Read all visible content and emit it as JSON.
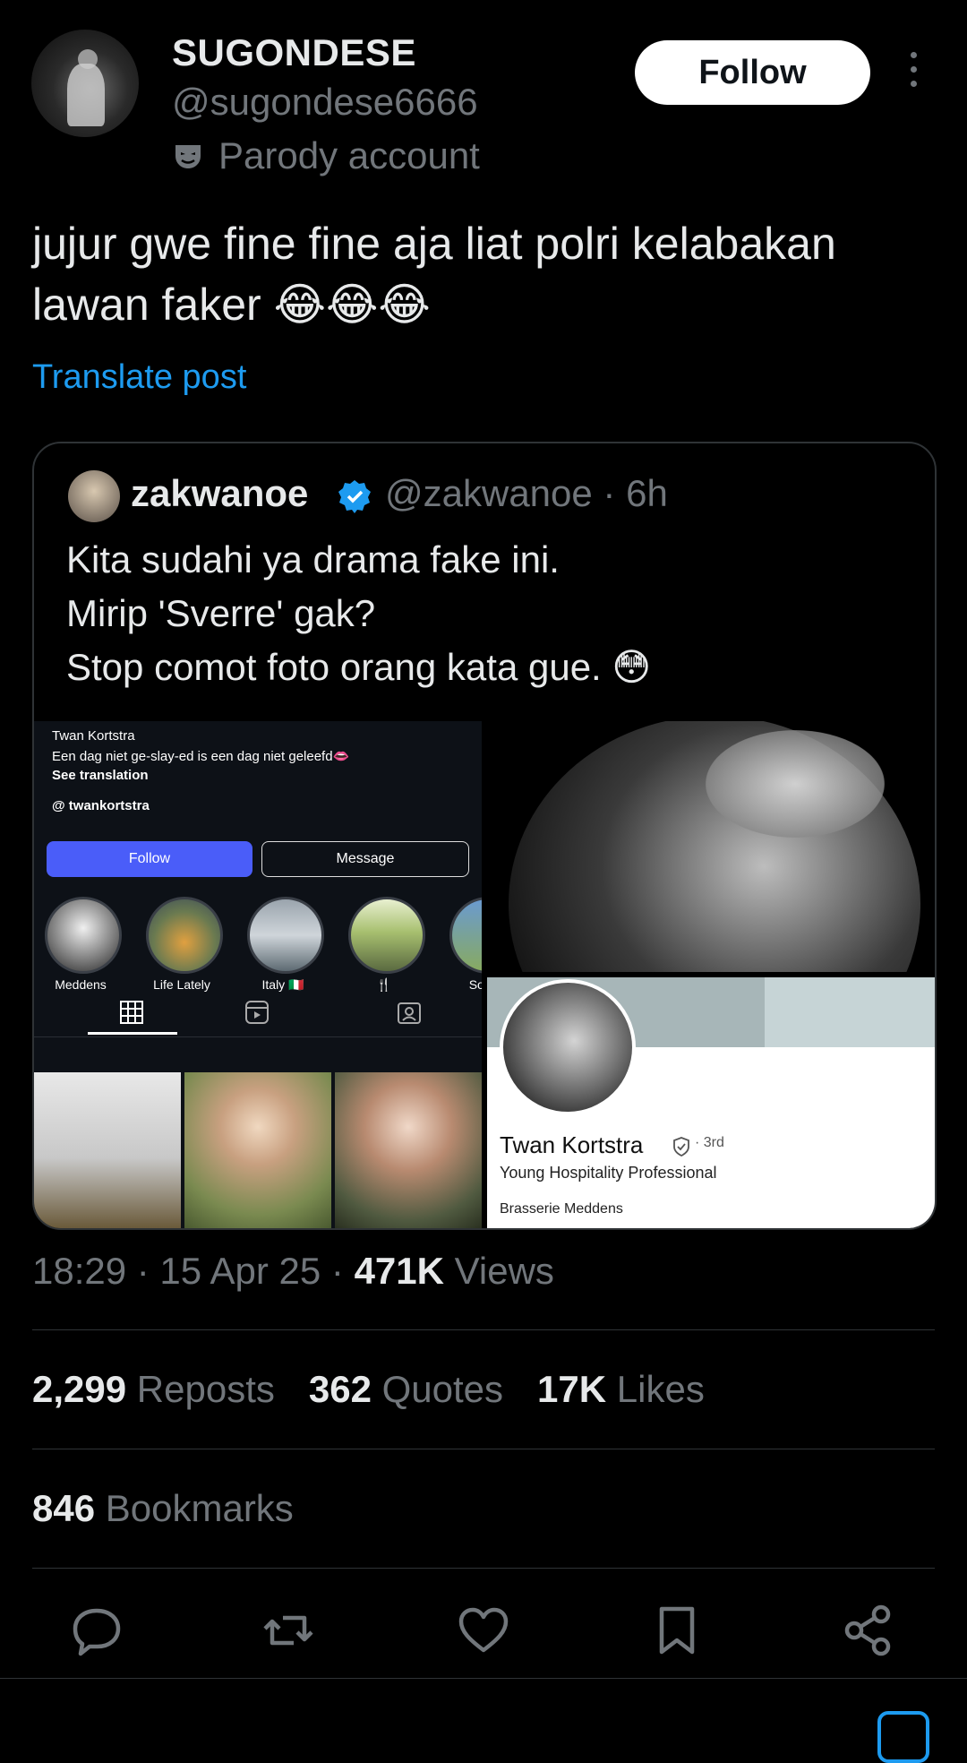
{
  "post": {
    "author_name": "SUGONDESE",
    "author_handle": "@sugondese6666",
    "parody_label": "Parody account",
    "follow_label": "Follow",
    "text_line1": "jujur gwe fine fine aja liat polri kelabakan",
    "text_line2": "lawan faker 😂😂😂",
    "translate_label": "Translate post"
  },
  "quote": {
    "name": "zakwanoe",
    "meta": "@zakwanoe · 6h",
    "text": "Kita sudahi ya drama fake ini.\nMirip 'Sverre' gak?\nStop comot foto orang kata gue. 😳"
  },
  "instagram": {
    "name": "Twan Kortstra",
    "bio": "Een dag niet ge-slay-ed is een dag niet geleefd👄",
    "see_translation": "See translation",
    "threads_handle": "twankortstra",
    "follow_label": "Follow",
    "message_label": "Message",
    "highlights": [
      "Meddens",
      "Life Lately",
      "Italy 🇮🇹",
      "🍴",
      "South"
    ]
  },
  "linkedin": {
    "name": "Twan Kortstra",
    "degree": "· 3rd",
    "title": "Young Hospitality Professional",
    "company": "Brasserie Meddens"
  },
  "footer": {
    "time": "18:29 · 15 Apr 25 · ",
    "views_count": "471K",
    "views_label": "Views",
    "reposts_count": "2,299",
    "reposts_label": "Reposts",
    "quotes_count": "362",
    "quotes_label": "Quotes",
    "likes_count": "17K",
    "likes_label": "Likes",
    "bookmarks_count": "846",
    "bookmarks_label": "Bookmarks"
  },
  "icons": {
    "reply": "reply-icon",
    "repost": "repost-icon",
    "like": "heart-icon",
    "bookmark": "bookmark-icon",
    "share": "share-icon"
  },
  "colors": {
    "accent": "#1d9bf0",
    "muted": "#71767b",
    "text": "#e7e9ea",
    "background": "#000000"
  }
}
